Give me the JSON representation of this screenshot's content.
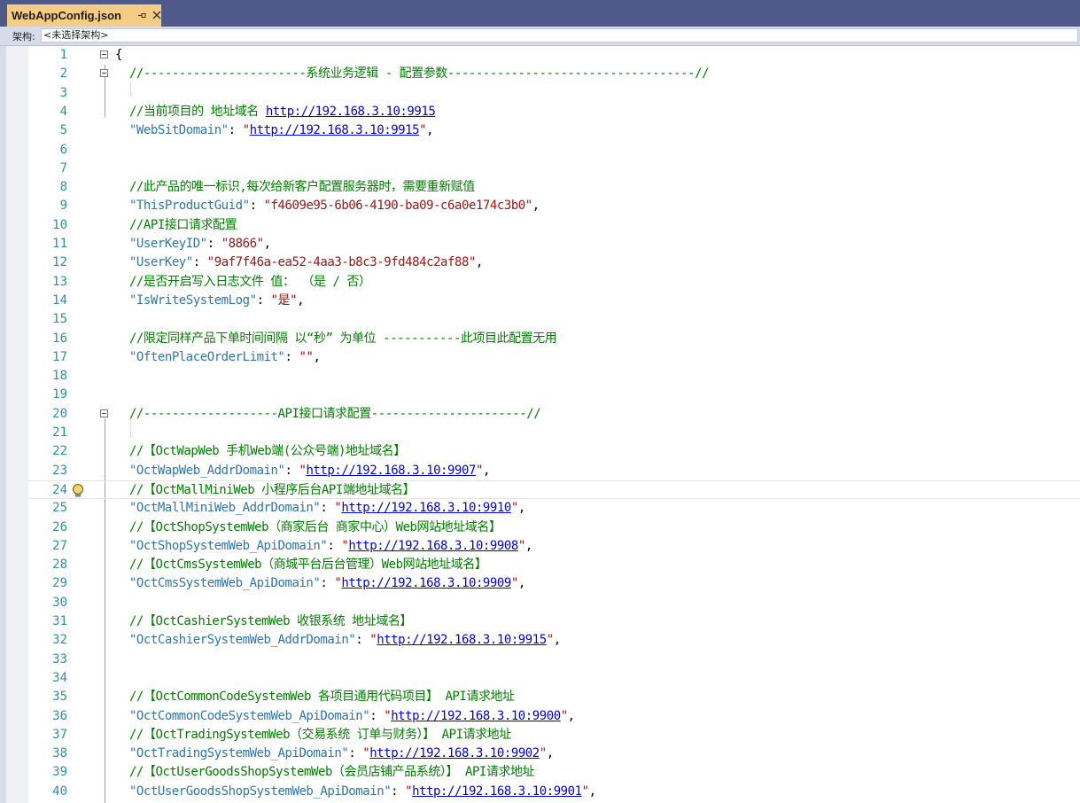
{
  "tab": {
    "title": "WebAppConfig.json",
    "pin_icon": "pin-icon",
    "close_icon": "close-icon",
    "active_color": "#f5cc84"
  },
  "toolbar": {
    "arch_label": "架构:",
    "arch_value": "<未选择架构>"
  },
  "colors": {
    "tabbar": "#4f5a89",
    "line_number": "#2b91af",
    "comment": "#008000",
    "key": "#2e75b6",
    "string": "#a31515",
    "link": "#0000ee"
  },
  "editor": {
    "current_line": 24,
    "lines": [
      {
        "n": "1",
        "fold": true,
        "segs": [
          {
            "t": "{",
            "c": "punct"
          }
        ]
      },
      {
        "n": "2",
        "fold": true,
        "segs": [
          {
            "t": "  //-----------------------系统业务逻辑 - 配置参数-----------------------------------//",
            "c": "comment"
          }
        ]
      },
      {
        "n": "3",
        "segs": []
      },
      {
        "n": "4",
        "segs": [
          {
            "t": "  //当前项目的 地址域名 ",
            "c": "comment"
          },
          {
            "t": "http://192.168.3.10:9915",
            "c": "link"
          }
        ]
      },
      {
        "n": "5",
        "segs": [
          {
            "t": "  \"WebSitDomain\"",
            "c": "key"
          },
          {
            "t": ": ",
            "c": "punct"
          },
          {
            "t": "\"",
            "c": "str"
          },
          {
            "t": "http://192.168.3.10:9915",
            "c": "link"
          },
          {
            "t": "\"",
            "c": "str"
          },
          {
            "t": ",",
            "c": "punct"
          }
        ]
      },
      {
        "n": "6",
        "segs": []
      },
      {
        "n": "7",
        "segs": []
      },
      {
        "n": "8",
        "segs": [
          {
            "t": "  //此产品的唯一标识,每次给新客户配置服务器时，需要重新赋值",
            "c": "comment"
          }
        ]
      },
      {
        "n": "9",
        "segs": [
          {
            "t": "  \"ThisProductGuid\"",
            "c": "key"
          },
          {
            "t": ": ",
            "c": "punct"
          },
          {
            "t": "\"f4609e95-6b06-4190-ba09-c6a0e174c3b0\"",
            "c": "str"
          },
          {
            "t": ",",
            "c": "punct"
          }
        ]
      },
      {
        "n": "10",
        "segs": [
          {
            "t": "  //API接口请求配置",
            "c": "comment"
          }
        ]
      },
      {
        "n": "11",
        "segs": [
          {
            "t": "  \"UserKeyID\"",
            "c": "key"
          },
          {
            "t": ": ",
            "c": "punct"
          },
          {
            "t": "\"8866\"",
            "c": "str"
          },
          {
            "t": ",",
            "c": "punct"
          }
        ]
      },
      {
        "n": "12",
        "segs": [
          {
            "t": "  \"UserKey\"",
            "c": "key"
          },
          {
            "t": ": ",
            "c": "punct"
          },
          {
            "t": "\"9af7f46a-ea52-4aa3-b8c3-9fd484c2af88\"",
            "c": "str"
          },
          {
            "t": ",",
            "c": "punct"
          }
        ]
      },
      {
        "n": "13",
        "segs": [
          {
            "t": "  //是否开启写入日志文件 值： （是 / 否）",
            "c": "comment"
          }
        ]
      },
      {
        "n": "14",
        "segs": [
          {
            "t": "  \"IsWriteSystemLog\"",
            "c": "key"
          },
          {
            "t": ": ",
            "c": "punct"
          },
          {
            "t": "\"是\"",
            "c": "str"
          },
          {
            "t": ",",
            "c": "punct"
          }
        ]
      },
      {
        "n": "15",
        "segs": []
      },
      {
        "n": "16",
        "segs": [
          {
            "t": "  //限定同样产品下单时间间隔 以“秒” 为单位 -----------此项目此配置无用",
            "c": "comment"
          }
        ]
      },
      {
        "n": "17",
        "segs": [
          {
            "t": "  \"OftenPlaceOrderLimit\"",
            "c": "key"
          },
          {
            "t": ": ",
            "c": "punct"
          },
          {
            "t": "\"\"",
            "c": "str"
          },
          {
            "t": ",",
            "c": "punct"
          }
        ]
      },
      {
        "n": "18",
        "segs": []
      },
      {
        "n": "19",
        "segs": []
      },
      {
        "n": "20",
        "fold": true,
        "segs": [
          {
            "t": "  //-------------------API接口请求配置----------------------//",
            "c": "comment"
          }
        ]
      },
      {
        "n": "21",
        "segs": []
      },
      {
        "n": "22",
        "segs": [
          {
            "t": "  //【OctWapWeb 手机Web端(公众号端)地址域名】",
            "c": "comment"
          }
        ]
      },
      {
        "n": "23",
        "segs": [
          {
            "t": "  \"OctWapWeb_AddrDomain\"",
            "c": "key"
          },
          {
            "t": ": ",
            "c": "punct"
          },
          {
            "t": "\"",
            "c": "str"
          },
          {
            "t": "http://192.168.3.10:9907",
            "c": "link"
          },
          {
            "t": "\"",
            "c": "str"
          },
          {
            "t": ",",
            "c": "punct"
          }
        ]
      },
      {
        "n": "24",
        "bulb": true,
        "segs": [
          {
            "t": "  //【OctMallMiniWeb 小程序后台API端地址域名】",
            "c": "comment"
          }
        ]
      },
      {
        "n": "25",
        "segs": [
          {
            "t": "  \"OctMallMiniWeb_AddrDomain\"",
            "c": "key"
          },
          {
            "t": ": ",
            "c": "punct"
          },
          {
            "t": "\"",
            "c": "str"
          },
          {
            "t": "http://192.168.3.10:9910",
            "c": "link"
          },
          {
            "t": "\"",
            "c": "str"
          },
          {
            "t": ",",
            "c": "punct"
          }
        ]
      },
      {
        "n": "26",
        "segs": [
          {
            "t": "  //【OctShopSystemWeb（商家后台 商家中心）Web网站地址域名】",
            "c": "comment"
          }
        ]
      },
      {
        "n": "27",
        "segs": [
          {
            "t": "  \"OctShopSystemWeb_ApiDomain\"",
            "c": "key"
          },
          {
            "t": ": ",
            "c": "punct"
          },
          {
            "t": "\"",
            "c": "str"
          },
          {
            "t": "http://192.168.3.10:9908",
            "c": "link"
          },
          {
            "t": "\"",
            "c": "str"
          },
          {
            "t": ",",
            "c": "punct"
          }
        ]
      },
      {
        "n": "28",
        "segs": [
          {
            "t": "  //【OctCmsSystemWeb（商城平台后台管理）Web网站地址域名】",
            "c": "comment"
          }
        ]
      },
      {
        "n": "29",
        "segs": [
          {
            "t": "  \"OctCmsSystemWeb_ApiDomain\"",
            "c": "key"
          },
          {
            "t": ": ",
            "c": "punct"
          },
          {
            "t": "\"",
            "c": "str"
          },
          {
            "t": "http://192.168.3.10:9909",
            "c": "link"
          },
          {
            "t": "\"",
            "c": "str"
          },
          {
            "t": ",",
            "c": "punct"
          }
        ]
      },
      {
        "n": "30",
        "segs": []
      },
      {
        "n": "31",
        "segs": [
          {
            "t": "  //【OctCashierSystemWeb 收银系统 地址域名】",
            "c": "comment"
          }
        ]
      },
      {
        "n": "32",
        "segs": [
          {
            "t": "  \"OctCashierSystemWeb_AddrDomain\"",
            "c": "key"
          },
          {
            "t": ": ",
            "c": "punct"
          },
          {
            "t": "\"",
            "c": "str"
          },
          {
            "t": "http://192.168.3.10:9915",
            "c": "link"
          },
          {
            "t": "\"",
            "c": "str"
          },
          {
            "t": ",",
            "c": "punct"
          }
        ]
      },
      {
        "n": "33",
        "segs": []
      },
      {
        "n": "34",
        "segs": []
      },
      {
        "n": "35",
        "segs": [
          {
            "t": "  //【OctCommonCodeSystemWeb 各项目通用代码项目】 API请求地址",
            "c": "comment"
          }
        ]
      },
      {
        "n": "36",
        "segs": [
          {
            "t": "  \"OctCommonCodeSystemWeb_ApiDomain\"",
            "c": "key"
          },
          {
            "t": ": ",
            "c": "punct"
          },
          {
            "t": "\"",
            "c": "str"
          },
          {
            "t": "http://192.168.3.10:9900",
            "c": "link"
          },
          {
            "t": "\"",
            "c": "str"
          },
          {
            "t": ",",
            "c": "punct"
          }
        ]
      },
      {
        "n": "37",
        "segs": [
          {
            "t": "  //【OctTradingSystemWeb（交易系统 订单与财务）】 API请求地址",
            "c": "comment"
          }
        ]
      },
      {
        "n": "38",
        "segs": [
          {
            "t": "  \"OctTradingSystemWeb_ApiDomain\"",
            "c": "key"
          },
          {
            "t": ": ",
            "c": "punct"
          },
          {
            "t": "\"",
            "c": "str"
          },
          {
            "t": "http://192.168.3.10:9902",
            "c": "link"
          },
          {
            "t": "\"",
            "c": "str"
          },
          {
            "t": ",",
            "c": "punct"
          }
        ]
      },
      {
        "n": "39",
        "segs": [
          {
            "t": "  //【OctUserGoodsShopSystemWeb（会员店铺产品系统）】 API请求地址",
            "c": "comment"
          }
        ]
      },
      {
        "n": "40",
        "segs": [
          {
            "t": "  \"OctUserGoodsShopSystemWeb_ApiDomain\"",
            "c": "key"
          },
          {
            "t": ": ",
            "c": "punct"
          },
          {
            "t": "\"",
            "c": "str"
          },
          {
            "t": "http://192.168.3.10:9901",
            "c": "link"
          },
          {
            "t": "\"",
            "c": "str"
          },
          {
            "t": ",",
            "c": "punct"
          }
        ]
      }
    ]
  }
}
